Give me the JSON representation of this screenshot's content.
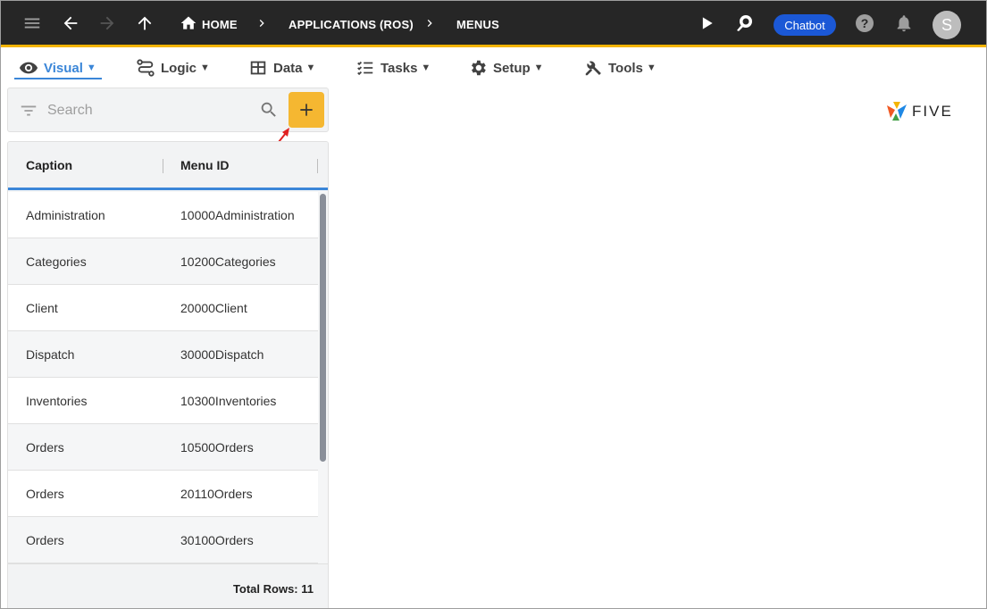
{
  "topbar": {
    "breadcrumbs": [
      "HOME",
      "APPLICATIONS (ROS)",
      "MENUS"
    ],
    "chatbot_label": "Chatbot",
    "avatar_initial": "S",
    "accent_color": "#f4b400"
  },
  "menubar": {
    "items": [
      {
        "label": "Visual",
        "icon": "eye-icon",
        "active": true
      },
      {
        "label": "Logic",
        "icon": "logic-flow-icon"
      },
      {
        "label": "Data",
        "icon": "table-icon"
      },
      {
        "label": "Tasks",
        "icon": "checklist-icon"
      },
      {
        "label": "Setup",
        "icon": "gear-icon"
      },
      {
        "label": "Tools",
        "icon": "tools-icon"
      }
    ],
    "caret": "▼",
    "logo_text": "FIVE"
  },
  "search": {
    "placeholder": "Search",
    "value": ""
  },
  "grid": {
    "columns": [
      "Caption",
      "Menu ID"
    ],
    "rows": [
      [
        "Administration",
        "10000Administration"
      ],
      [
        "Categories",
        "10200Categories"
      ],
      [
        "Client",
        "20000Client"
      ],
      [
        "Dispatch",
        "30000Dispatch"
      ],
      [
        "Inventories",
        "10300Inventories"
      ],
      [
        "Orders",
        "10500Orders"
      ],
      [
        "Orders",
        "20110Orders"
      ],
      [
        "Orders",
        "30100Orders"
      ]
    ],
    "total_rows": "Total Rows: 11"
  },
  "colors": {
    "add_button": "#f5b731",
    "active_tab": "#3b86d8",
    "chatbot": "#1b58d6"
  }
}
